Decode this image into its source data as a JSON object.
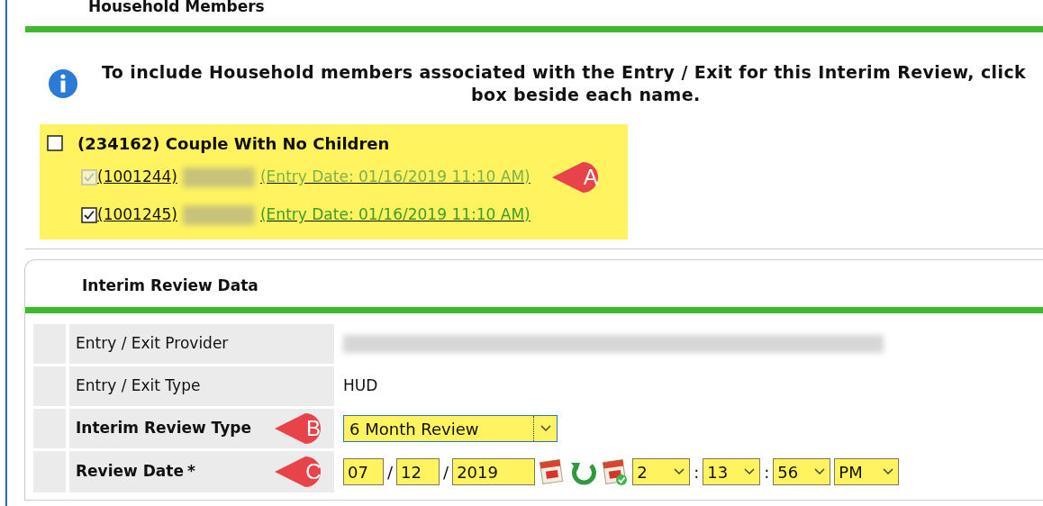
{
  "section_header": "Household Members",
  "info": {
    "lines": [
      "To include Household members associated with the Entry / Exit for this Interim Review, click",
      "box beside each name."
    ]
  },
  "household": {
    "label": "(234162) Couple With No Children",
    "checked": false,
    "members": [
      {
        "id": "(1001244)",
        "entry": "(Entry Date: 01/16/2019 11:10 AM)",
        "checked": true,
        "disabled": true,
        "callout": "A"
      },
      {
        "id": "(1001245)",
        "entry": "(Entry Date: 01/16/2019 11:10 AM)",
        "checked": true,
        "disabled": false
      }
    ]
  },
  "review": {
    "title": "Interim Review Data",
    "rows": [
      {
        "kind": "redacted",
        "label": "Entry / Exit Provider",
        "emphasis": false
      },
      {
        "kind": "text",
        "label": "Entry / Exit Type",
        "value": "HUD",
        "emphasis": false
      },
      {
        "kind": "select",
        "label": "Interim Review Type",
        "value": "6 Month Review",
        "emphasis": true,
        "callout": "B"
      },
      {
        "kind": "datetime",
        "label": "Review Date",
        "required_mark": "*",
        "emphasis": true,
        "callout": "C",
        "month": "07",
        "sep1": "/",
        "day": "12",
        "sep2": "/",
        "year": "2019",
        "hour": "2",
        "tsep1": ":",
        "minute": "13",
        "tsep2": ":",
        "second": "56",
        "ampm": "PM"
      }
    ]
  }
}
